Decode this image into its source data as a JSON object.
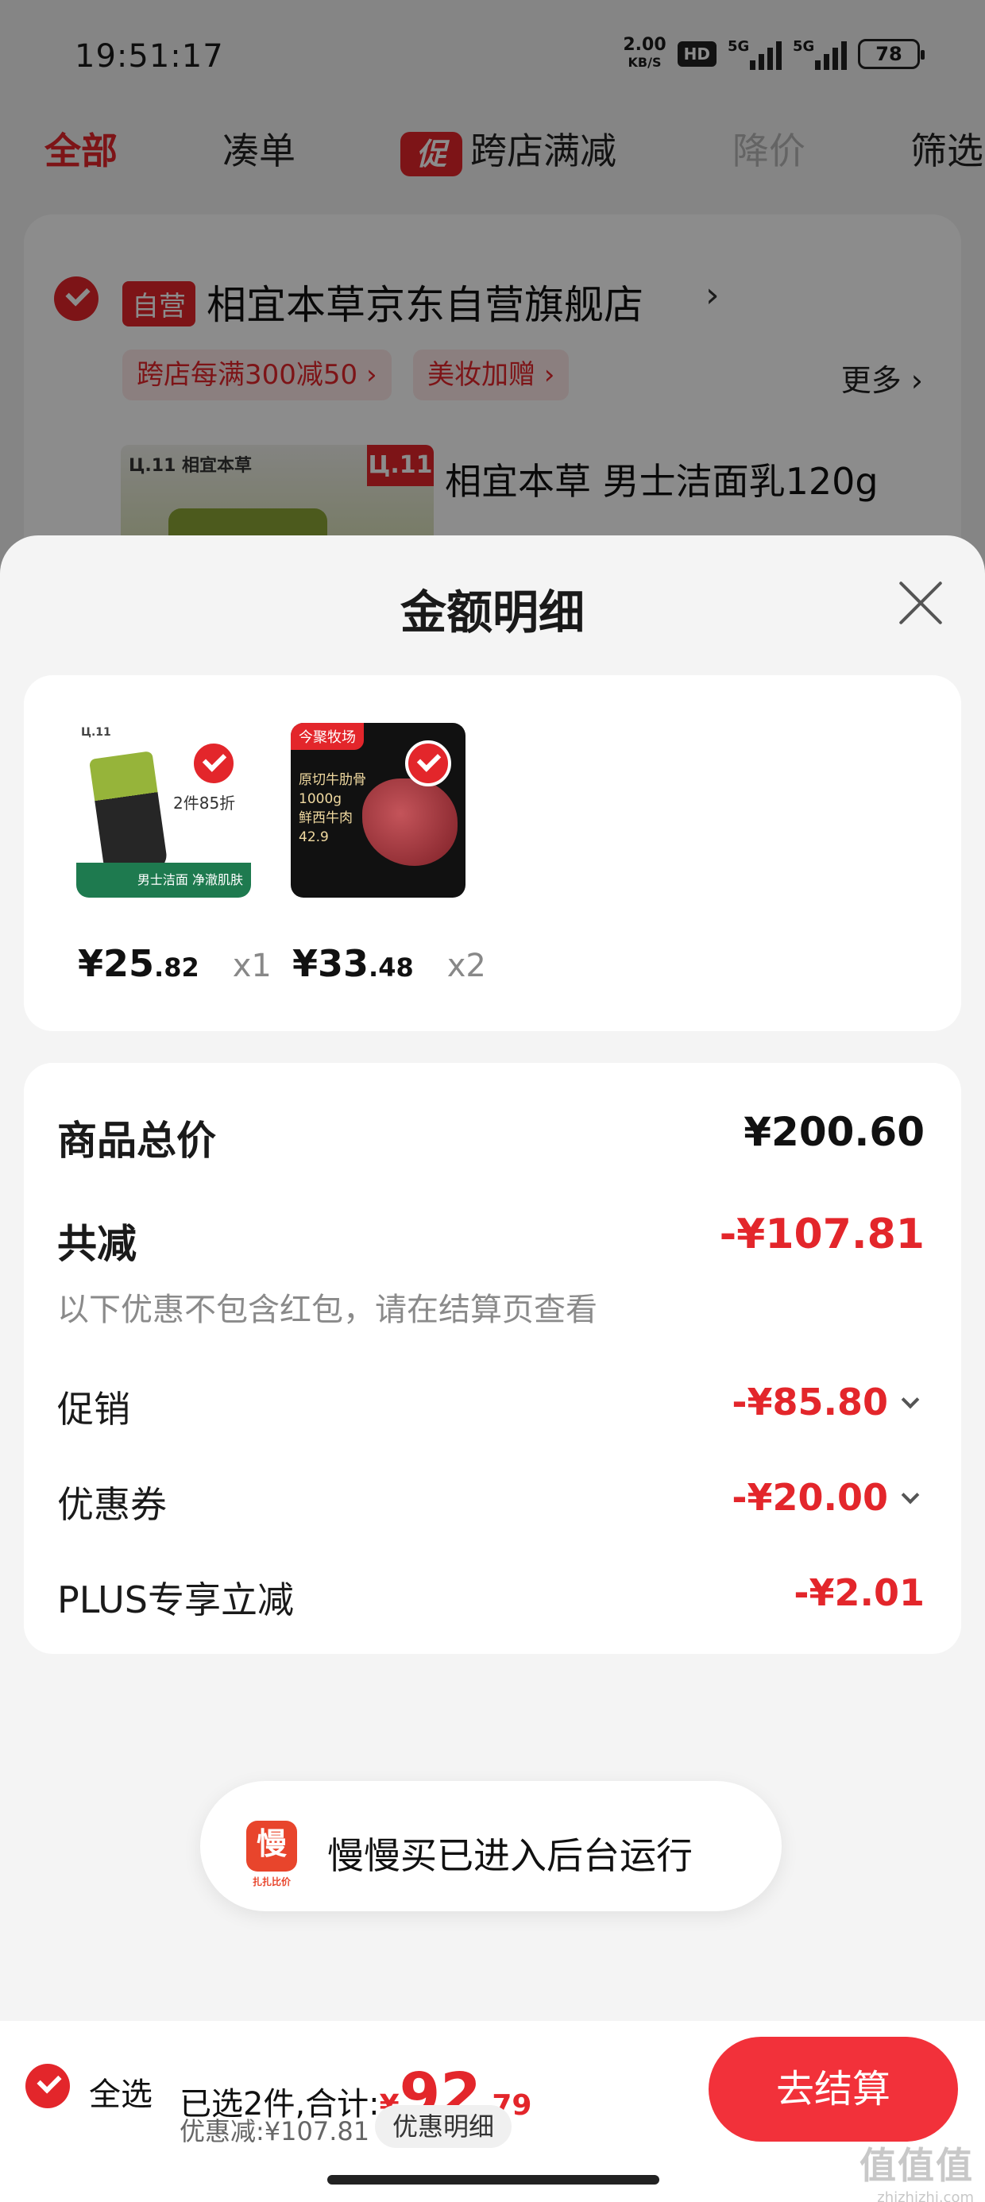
{
  "status_bar": {
    "time": "19:51:17",
    "net_speed": "2.00",
    "net_unit": "KB/S",
    "hd": "HD",
    "signal1_tag": "5G",
    "signal2_tag": "5G",
    "battery": "78"
  },
  "filter_tabs": {
    "all": "全部",
    "combine": "凑单",
    "promo_icon": "促",
    "cross_store": "跨店满减",
    "price_drop": "降价",
    "filter": "筛选"
  },
  "store": {
    "self_badge": "自营",
    "name": "相宜本草京东自营旗舰店",
    "arrow": "›",
    "tag1": "跨店每满300减50 ›",
    "tag2": "美妆加赠 ›",
    "more": "更多 ›",
    "product_logo": "Ц.11 相宜本草",
    "product_badge": "Ц.11",
    "product_title": "相宜本草 男士洁面乳120g"
  },
  "sheet": {
    "title": "金额明细",
    "items": [
      {
        "price_int": "¥25",
        "price_dec": ".82",
        "qty": "x1",
        "img_tag": "男士洁面 净澈肌肤",
        "img_label": "2件85折",
        "img_header": "Ц.11"
      },
      {
        "price_int": "¥33",
        "price_dec": ".48",
        "qty": "x2",
        "img_brand": "今聚牧场",
        "img_text": "原切牛肋骨\n1000g\n鲜西牛肉\n42.9"
      }
    ],
    "summary": {
      "total_label": "商品总价",
      "total_value": "¥200.60",
      "reduce_label": "共减",
      "reduce_value": "-¥107.81",
      "note": "以下优惠不包含红包，请在结算页查看",
      "promo_label": "促销",
      "promo_value": "-¥85.80",
      "coupon_label": "优惠券",
      "coupon_value": "-¥20.00",
      "plus_label": "PLUS专享立减",
      "plus_value": "-¥2.01"
    }
  },
  "toast": {
    "icon_char": "慢",
    "icon_caption": "扎扎比价",
    "text": "慢慢买已进入后台运行"
  },
  "checkout": {
    "select_all": "全选",
    "selected": "已选2件,合计:",
    "yen": "¥",
    "total_int": "92",
    "total_dec": ".79",
    "discount": "优惠减:¥107.81",
    "detail_button": "优惠明细",
    "pay_button": "去结算"
  },
  "watermark": {
    "text": "值值值",
    "site": "zhizhizhi.com"
  },
  "colors": {
    "accent": "#e3262b",
    "pay_button": "#f2313a"
  }
}
